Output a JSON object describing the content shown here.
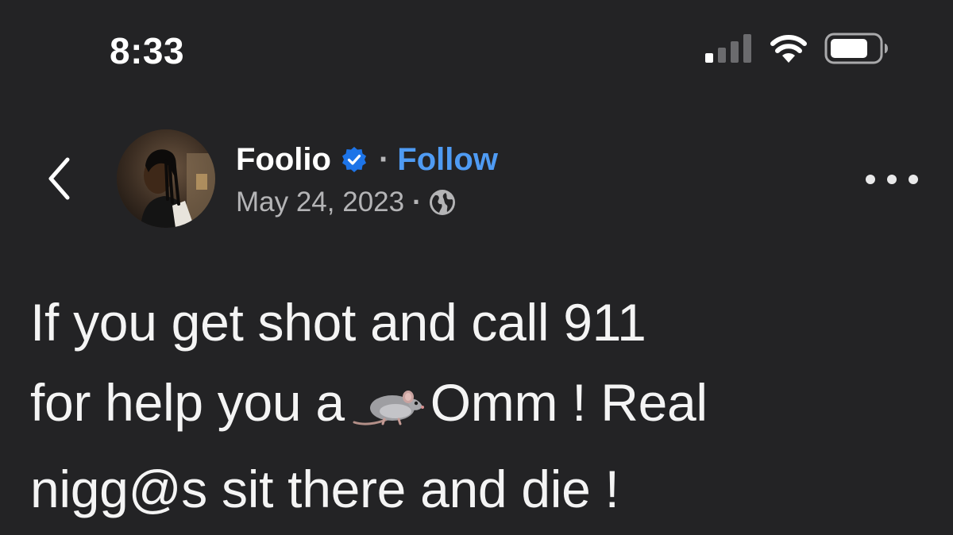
{
  "status_bar": {
    "time": "8:33",
    "signal_icon": "cellular-signal-icon",
    "wifi_icon": "wifi-icon",
    "battery_icon": "battery-icon"
  },
  "post": {
    "author": {
      "name": "Foolio",
      "verified": true,
      "follow_label": "Follow"
    },
    "separator": "·",
    "date": "May 24, 2023",
    "audience_icon": "globe-icon",
    "text_lines": {
      "line1": "If you get shot and call 911",
      "line2_before": "for help you a",
      "line2_emoji": "rat-emoji",
      "line2_after": "Omm ! Real",
      "line3": "nigg@s sit there and die !"
    }
  },
  "icons": {
    "back": "chevron-left-icon",
    "more": "more-horizontal-icon",
    "verified": "verified-badge-icon"
  },
  "colors": {
    "background": "#232325",
    "link": "#4f9bf3",
    "verified_badge": "#1d74e8",
    "secondary_text": "#b4b4b6"
  }
}
